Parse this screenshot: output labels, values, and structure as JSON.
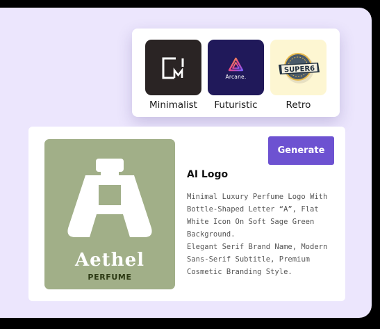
{
  "styles": [
    {
      "label": "Minimalist"
    },
    {
      "label": "Futuristic",
      "logo_text": "Arcane."
    },
    {
      "label": "Retro",
      "logo_text": "SUPER6"
    }
  ],
  "card": {
    "generate_label": "Generate",
    "title": "AI Logo",
    "description": [
      "Minimal Luxury Perfume Logo With Bottle-Shaped Letter “A”, Flat White Icon On Soft Sage Green Background.",
      "Elegant Serif Brand Name, Modern Sans-Serif Subtitle, Premium Cosmetic Branding Style."
    ],
    "brand_name": "Aethel",
    "brand_subtitle": "PERFUME"
  },
  "colors": {
    "panel_bg": "#ece6fd",
    "accent": "#6d52d1",
    "sage": "#a1af88",
    "minimalist_tile": "#2a2424",
    "futuristic_tile": "#20195a",
    "retro_tile": "#fdf6d2"
  },
  "icons": [
    "minimalist-logo-icon",
    "arcane-triangle-icon",
    "retro-badge-icon",
    "bottle-a-icon"
  ]
}
